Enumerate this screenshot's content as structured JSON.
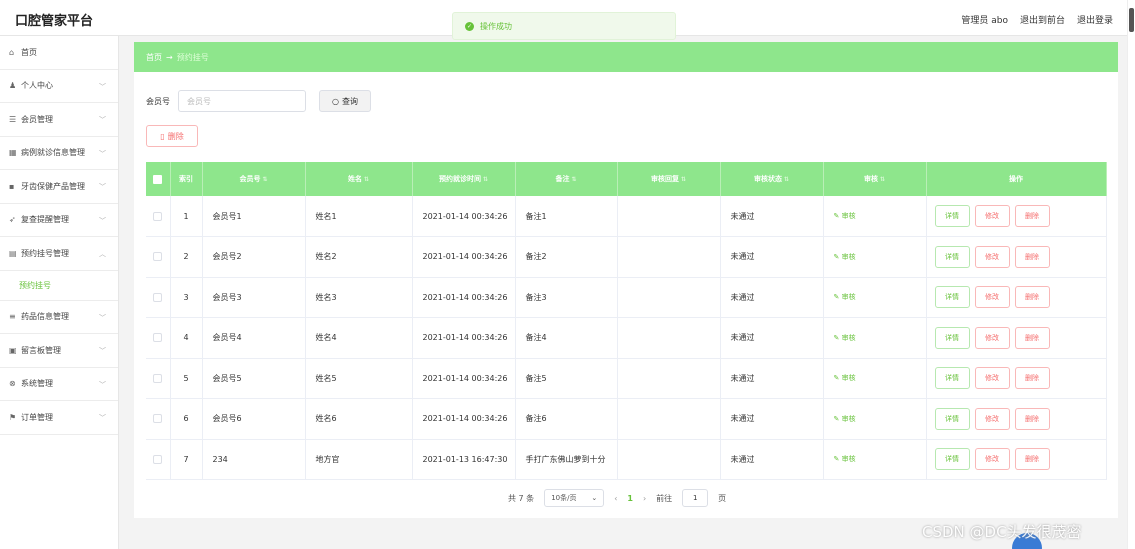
{
  "header": {
    "brand": "口腔管家平台",
    "user": "管理员 abo",
    "back_front": "退出到前台",
    "logout": "退出登录"
  },
  "toast": {
    "message": "操作成功"
  },
  "sidebar": {
    "items": [
      {
        "label": "首页",
        "icon": "home-icon",
        "glyph": "⌂"
      },
      {
        "label": "个人中心",
        "icon": "user-icon",
        "glyph": "♟"
      },
      {
        "label": "会员管理",
        "icon": "list-icon",
        "glyph": "☰"
      },
      {
        "label": "病例就诊信息管理",
        "icon": "grid-icon",
        "glyph": "▦"
      },
      {
        "label": "牙齿保健产品管理",
        "icon": "apps-icon",
        "glyph": "▪"
      },
      {
        "label": "复查提醒管理",
        "icon": "send-icon",
        "glyph": "➶"
      },
      {
        "label": "预约挂号管理",
        "icon": "calendar-icon",
        "glyph": "▤"
      },
      {
        "label": "药品信息管理",
        "icon": "menu-icon",
        "glyph": "≡"
      },
      {
        "label": "留言板管理",
        "icon": "board-icon",
        "glyph": "▣"
      },
      {
        "label": "系统管理",
        "icon": "settings-icon",
        "glyph": "⊗"
      },
      {
        "label": "订单管理",
        "icon": "flag-icon",
        "glyph": "⚑"
      }
    ],
    "submenu": "预约挂号"
  },
  "breadcrumb": {
    "home": "首页",
    "arrow": "→",
    "current": "预约挂号"
  },
  "search": {
    "label": "会员号",
    "placeholder": "会员号",
    "button": "查询"
  },
  "toolbar": {
    "delete": "删除"
  },
  "table": {
    "headers": [
      "索引",
      "会员号",
      "姓名",
      "预约就诊时间",
      "备注",
      "审核回复",
      "审核状态",
      "审核",
      "操作"
    ],
    "rows": [
      {
        "idx": "1",
        "member": "会员号1",
        "name": "姓名1",
        "time": "2021-01-14 00:34:26",
        "note": "备注1",
        "reply": "",
        "status": "未通过",
        "audit": "审核"
      },
      {
        "idx": "2",
        "member": "会员号2",
        "name": "姓名2",
        "time": "2021-01-14 00:34:26",
        "note": "备注2",
        "reply": "",
        "status": "未通过",
        "audit": "审核"
      },
      {
        "idx": "3",
        "member": "会员号3",
        "name": "姓名3",
        "time": "2021-01-14 00:34:26",
        "note": "备注3",
        "reply": "",
        "status": "未通过",
        "audit": "审核"
      },
      {
        "idx": "4",
        "member": "会员号4",
        "name": "姓名4",
        "time": "2021-01-14 00:34:26",
        "note": "备注4",
        "reply": "",
        "status": "未通过",
        "audit": "审核"
      },
      {
        "idx": "5",
        "member": "会员号5",
        "name": "姓名5",
        "time": "2021-01-14 00:34:26",
        "note": "备注5",
        "reply": "",
        "status": "未通过",
        "audit": "审核"
      },
      {
        "idx": "6",
        "member": "会员号6",
        "name": "姓名6",
        "time": "2021-01-14 00:34:26",
        "note": "备注6",
        "reply": "",
        "status": "未通过",
        "audit": "审核"
      },
      {
        "idx": "7",
        "member": "234",
        "name": "地方官",
        "time": "2021-01-13 16:47:30",
        "note": "手打广东佛山萝到十分",
        "reply": "",
        "status": "未通过",
        "audit": "审核"
      }
    ],
    "ops": {
      "detail": "详情",
      "edit": "修改",
      "delete": "删除"
    }
  },
  "pagination": {
    "total": "共 7 条",
    "page_size": "10条/页",
    "current": "1",
    "goto_label": "前往",
    "goto_value": "1",
    "page_unit": "页"
  },
  "watermark": "CSDN @DC头发很茂密",
  "colors": {
    "accent": "#8ee68c",
    "success": "#67c23a",
    "danger": "#f56c6c"
  }
}
